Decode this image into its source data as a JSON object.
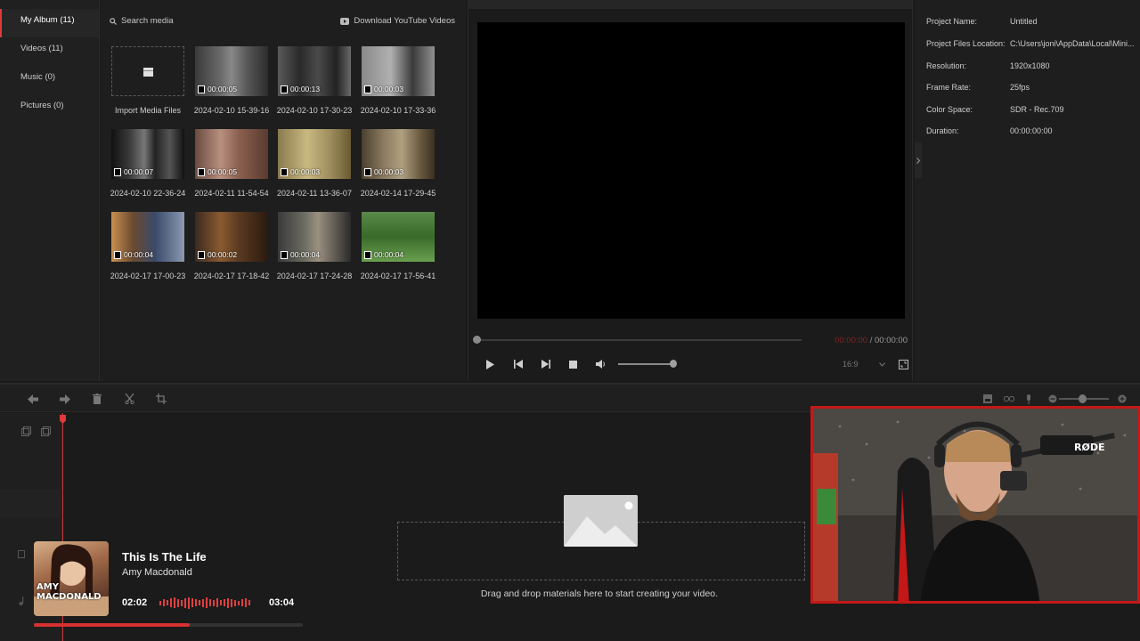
{
  "sidebar": {
    "items": [
      {
        "label": "My Album (11)"
      },
      {
        "label": "Videos (11)"
      },
      {
        "label": "Music (0)"
      },
      {
        "label": "Pictures (0)"
      }
    ]
  },
  "media": {
    "search_label": "Search media",
    "youtube_label": "Download YouTube Videos",
    "import_label": "Import Media Files",
    "items": [
      {
        "duration": "00:00:05",
        "name": "2024-02-10 15-39-16"
      },
      {
        "duration": "00:00:13",
        "name": "2024-02-10 17-30-23"
      },
      {
        "duration": "00:00:03",
        "name": "2024-02-10 17-33-36"
      },
      {
        "duration": "00:00:07",
        "name": "2024-02-10 22-36-24"
      },
      {
        "duration": "00:00:05",
        "name": "2024-02-11 11-54-54"
      },
      {
        "duration": "00:00:03",
        "name": "2024-02-11 13-36-07"
      },
      {
        "duration": "00:00:03",
        "name": "2024-02-14 17-29-45"
      },
      {
        "duration": "00:00:04",
        "name": "2024-02-17 17-00-23"
      },
      {
        "duration": "00:00:02",
        "name": "2024-02-17 17-18-42"
      },
      {
        "duration": "00:00:04",
        "name": "2024-02-17 17-24-28"
      },
      {
        "duration": "00:00:04",
        "name": "2024-02-17 17-56-41"
      }
    ]
  },
  "preview": {
    "current_time": "00:00:00",
    "separator": " / ",
    "total_time": "00:00:00",
    "aspect_ratio": "16:9"
  },
  "properties": {
    "rows": [
      {
        "key": "Project Name:",
        "value": "Untitled"
      },
      {
        "key": "Project Files Location:",
        "value": "C:\\Users\\joni\\AppData\\Local\\Mini..."
      },
      {
        "key": "Resolution:",
        "value": "1920x1080"
      },
      {
        "key": "Frame Rate:",
        "value": "25fps"
      },
      {
        "key": "Color Space:",
        "value": "SDR - Rec.709"
      },
      {
        "key": "Duration:",
        "value": "00:00:00:00"
      }
    ]
  },
  "timeline": {
    "drop_text": "Drag and drop materials here to start creating your video."
  },
  "now_playing": {
    "title": "This Is The Life",
    "artist": "Amy Macdonald",
    "elapsed": "02:02",
    "total": "03:04",
    "progress": 0.58,
    "cover_text": "AMY MACDONALD"
  },
  "webcam": {
    "mic_brand": "RØDE"
  },
  "colors": {
    "accent": "#e03a3a"
  }
}
